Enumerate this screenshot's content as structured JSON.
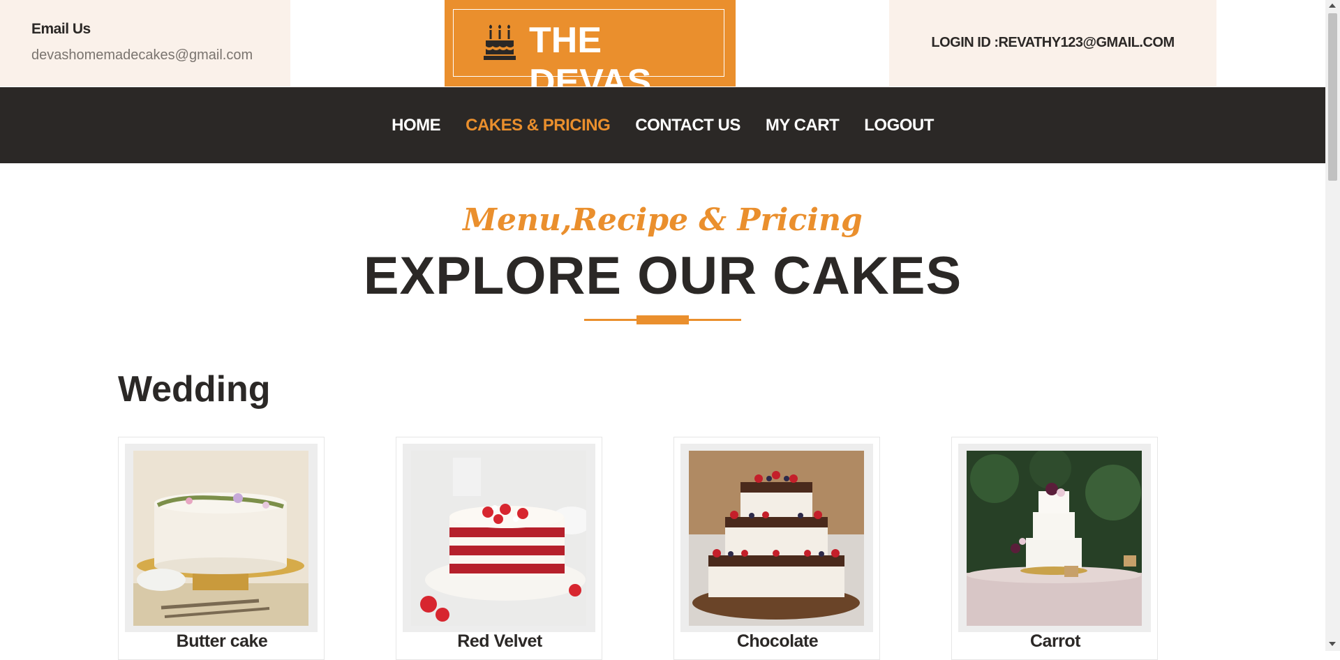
{
  "header": {
    "email_label": "Email Us",
    "email_value": "devashomemadecakes@gmail.com",
    "brand": "THE DEVAS",
    "brand_icon": "birthday-cake-icon",
    "login_text": "LOGIN ID :REVATHY123@GMAIL.COM"
  },
  "nav": {
    "items": [
      {
        "label": "HOME",
        "active": false
      },
      {
        "label": "CAKES & PRICING",
        "active": true
      },
      {
        "label": "CONTACT US",
        "active": false
      },
      {
        "label": "MY CART",
        "active": false
      },
      {
        "label": "LOGOUT",
        "active": false
      }
    ]
  },
  "main": {
    "subtitle": "Menu,Recipe & Pricing",
    "title": "EXPLORE OUR CAKES",
    "section_title": "Wedding",
    "cakes": [
      {
        "name": "Butter cake"
      },
      {
        "name": "Red Velvet"
      },
      {
        "name": "Chocolate"
      },
      {
        "name": "Carrot"
      }
    ]
  },
  "colors": {
    "accent": "#ea8f2d",
    "dark": "#2b2826",
    "cream": "#faf1ea"
  }
}
